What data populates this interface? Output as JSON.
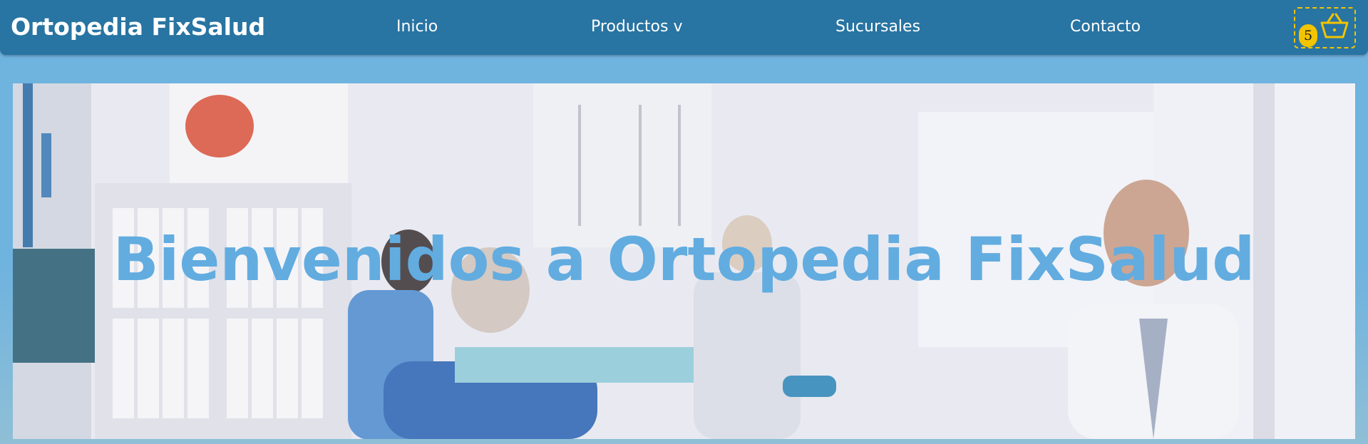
{
  "navbar": {
    "brand": "Ortopedia FixSalud",
    "links": [
      {
        "label": "Inicio"
      },
      {
        "label": "Productos v"
      },
      {
        "label": "Sucursales"
      },
      {
        "label": "Contacto"
      }
    ],
    "cart": {
      "icon": "basket-icon",
      "count": "5"
    }
  },
  "hero": {
    "title": "Bienvenidos a Ortopedia FixSalud",
    "image": "physiotherapy-clinic-photo"
  },
  "colors": {
    "navbar": "#2874a2",
    "page_background": "#6fb3df",
    "hero_title": "#62ace0",
    "cart_accent": "#f3c400"
  }
}
